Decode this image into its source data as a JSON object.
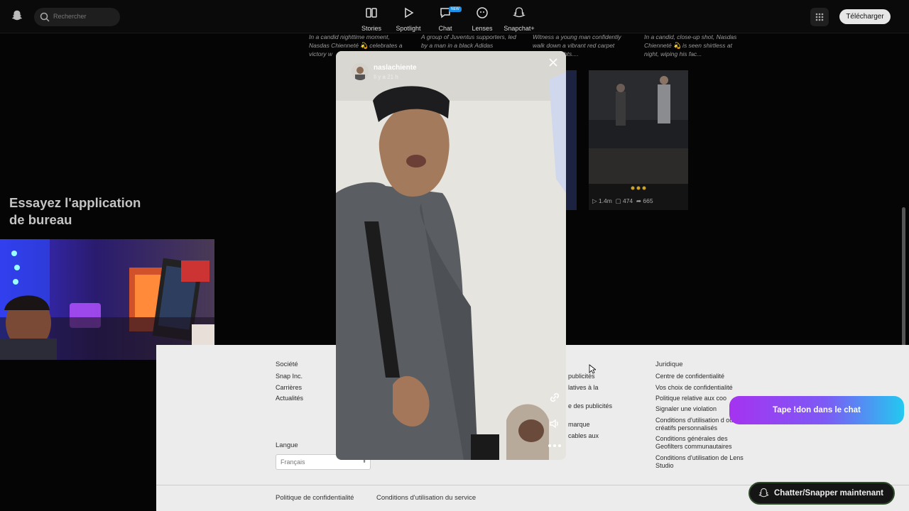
{
  "topbar": {
    "search_placeholder": "Rechercher",
    "nav": [
      {
        "label": "Stories",
        "icon": "stories-icon"
      },
      {
        "label": "Spotlight",
        "icon": "play-icon"
      },
      {
        "label": "Chat",
        "icon": "chat-icon",
        "badge": "NEW"
      },
      {
        "label": "Lenses",
        "icon": "lens-icon"
      },
      {
        "label": "Snapchat+",
        "icon": "ghost-plus-icon"
      }
    ],
    "download_label": "Télécharger"
  },
  "captions": [
    "In a candid nighttime moment, Nasdas Chienneté 💫 celebrates a victory w",
    "A group of Juventus supporters, led by a man in a black Adidas",
    "Witness a young man confidently walk down a vibrant red carpet featuring lights....",
    "In a candid, close-up shot, Nasdas Chienneté 💫 is seen shirtless at night, wiping his fac..."
  ],
  "card": {
    "views": "1.4m",
    "comments": "474",
    "shares": "665"
  },
  "promo": {
    "title": "Essayez l'application de bureau"
  },
  "story": {
    "username": "naslachiente",
    "time": "Il y a 21 h"
  },
  "footer": {
    "societe": {
      "title": "Société",
      "links": [
        "Snap Inc.",
        "Carrières",
        "Actualités"
      ]
    },
    "middle_links": [
      "publicités",
      "latives à la",
      "e des publicités",
      "marque",
      "cables aux"
    ],
    "juridique": {
      "title": "Juridique",
      "links": [
        "Centre de confidentialité",
        "Vos choix de confidentialité",
        "Politique relative aux coo",
        "Signaler une violation",
        "Conditions d'utilisation d outils créatifs personnalisés",
        "Conditions générales des Geofilters communautaires",
        "Conditions d'utilisation de Lens Studio"
      ]
    },
    "langue_label": "Langue",
    "langue_value": "Français",
    "bottom_links": [
      "Politique de confidentialité",
      "Conditions d'utilisation du service"
    ]
  },
  "overlays": {
    "tip": "Tape !don dans le chat",
    "chat_button": "Chatter/Snapper maintenant"
  }
}
